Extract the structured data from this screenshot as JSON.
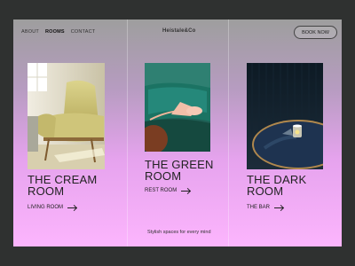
{
  "nav": {
    "about": "ABOUT",
    "rooms": "ROOMS",
    "contact": "CONTACT"
  },
  "brand": "Heistale&Co",
  "book_label": "BOOK NOW",
  "cards": [
    {
      "title_line1": "THE CREAM",
      "title_line2": "ROOM",
      "link": "LIVING ROOM"
    },
    {
      "title_line1": "THE GREEN",
      "title_line2": "ROOM",
      "link": "REST ROOM"
    },
    {
      "title_line1": "THE DARK",
      "title_line2": "ROOM",
      "link": "THE BAR"
    }
  ],
  "tagline": "Stylish spaces for every mind",
  "colors": {
    "background": "#2f3130",
    "frame_top": "#9e9e9e",
    "frame_bottom": "#fcb5fd"
  }
}
